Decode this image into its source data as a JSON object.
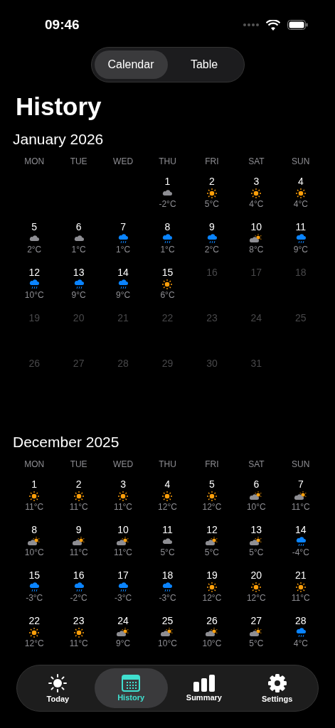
{
  "status_bar": {
    "time": "09:46"
  },
  "segments": [
    {
      "label": "Calendar",
      "selected": true
    },
    {
      "label": "Table",
      "selected": false
    }
  ],
  "title": "History",
  "months": [
    {
      "title": "January 2026",
      "weekdays": [
        "MON",
        "TUE",
        "WED",
        "THU",
        "FRI",
        "SAT",
        "SUN"
      ],
      "days": [
        {
          "kind": "empty"
        },
        {
          "kind": "empty"
        },
        {
          "kind": "empty"
        },
        {
          "kind": "cloud",
          "day": "1",
          "temp": "-2°C"
        },
        {
          "kind": "sun",
          "day": "2",
          "temp": "5°C"
        },
        {
          "kind": "sun",
          "day": "3",
          "temp": "4°C"
        },
        {
          "kind": "sun",
          "day": "4",
          "temp": "4°C"
        },
        {
          "kind": "cloud",
          "day": "5",
          "temp": "2°C"
        },
        {
          "kind": "cloud",
          "day": "6",
          "temp": "1°C"
        },
        {
          "kind": "rain",
          "day": "7",
          "temp": "1°C"
        },
        {
          "kind": "rain",
          "day": "8",
          "temp": "1°C"
        },
        {
          "kind": "rain",
          "day": "9",
          "temp": "2°C"
        },
        {
          "kind": "partly",
          "day": "10",
          "temp": "8°C"
        },
        {
          "kind": "rain",
          "day": "11",
          "temp": "9°C"
        },
        {
          "kind": "rain",
          "day": "12",
          "temp": "10°C"
        },
        {
          "kind": "rain",
          "day": "13",
          "temp": "9°C"
        },
        {
          "kind": "rain",
          "day": "14",
          "temp": "9°C"
        },
        {
          "kind": "sun",
          "day": "15",
          "temp": "6°C"
        },
        {
          "kind": "future",
          "day": "16"
        },
        {
          "kind": "future",
          "day": "17"
        },
        {
          "kind": "future",
          "day": "18"
        },
        {
          "kind": "future",
          "day": "19"
        },
        {
          "kind": "future",
          "day": "20"
        },
        {
          "kind": "future",
          "day": "21"
        },
        {
          "kind": "future",
          "day": "22"
        },
        {
          "kind": "future",
          "day": "23"
        },
        {
          "kind": "future",
          "day": "24"
        },
        {
          "kind": "future",
          "day": "25"
        },
        {
          "kind": "future",
          "day": "26"
        },
        {
          "kind": "future",
          "day": "27"
        },
        {
          "kind": "future",
          "day": "28"
        },
        {
          "kind": "future",
          "day": "29"
        },
        {
          "kind": "future",
          "day": "30"
        },
        {
          "kind": "future",
          "day": "31"
        }
      ]
    },
    {
      "title": "December 2025",
      "weekdays": [
        "MON",
        "TUE",
        "WED",
        "THU",
        "FRI",
        "SAT",
        "SUN"
      ],
      "days": [
        {
          "kind": "sun",
          "day": "1",
          "temp": "11°C"
        },
        {
          "kind": "sun",
          "day": "2",
          "temp": "11°C"
        },
        {
          "kind": "sun",
          "day": "3",
          "temp": "11°C"
        },
        {
          "kind": "sun",
          "day": "4",
          "temp": "12°C"
        },
        {
          "kind": "sun",
          "day": "5",
          "temp": "12°C"
        },
        {
          "kind": "partly",
          "day": "6",
          "temp": "10°C"
        },
        {
          "kind": "partly",
          "day": "7",
          "temp": "11°C"
        },
        {
          "kind": "partly",
          "day": "8",
          "temp": "10°C"
        },
        {
          "kind": "partly",
          "day": "9",
          "temp": "11°C"
        },
        {
          "kind": "partly",
          "day": "10",
          "temp": "11°C"
        },
        {
          "kind": "cloud",
          "day": "11",
          "temp": "5°C"
        },
        {
          "kind": "partly",
          "day": "12",
          "temp": "5°C"
        },
        {
          "kind": "partly",
          "day": "13",
          "temp": "5°C"
        },
        {
          "kind": "rain",
          "day": "14",
          "temp": "-4°C"
        },
        {
          "kind": "rain",
          "day": "15",
          "temp": "-3°C"
        },
        {
          "kind": "rain",
          "day": "16",
          "temp": "-2°C"
        },
        {
          "kind": "rain",
          "day": "17",
          "temp": "-3°C"
        },
        {
          "kind": "rain",
          "day": "18",
          "temp": "-3°C"
        },
        {
          "kind": "sun",
          "day": "19",
          "temp": "12°C"
        },
        {
          "kind": "sun",
          "day": "20",
          "temp": "12°C"
        },
        {
          "kind": "sun",
          "day": "21",
          "temp": "11°C"
        },
        {
          "kind": "sun",
          "day": "22",
          "temp": "12°C"
        },
        {
          "kind": "sun",
          "day": "23",
          "temp": "11°C"
        },
        {
          "kind": "partly",
          "day": "24",
          "temp": "9°C"
        },
        {
          "kind": "partly",
          "day": "25",
          "temp": "10°C"
        },
        {
          "kind": "partly",
          "day": "26",
          "temp": "10°C"
        },
        {
          "kind": "partly",
          "day": "27",
          "temp": "5°C"
        },
        {
          "kind": "rain",
          "day": "28",
          "temp": "4°C"
        }
      ]
    }
  ],
  "tab_bar": [
    {
      "kind": "today",
      "label": "Today",
      "selected": false
    },
    {
      "kind": "history",
      "label": "History",
      "selected": true
    },
    {
      "kind": "summary",
      "label": "Summary",
      "selected": false
    },
    {
      "kind": "settings",
      "label": "Settings",
      "selected": false
    }
  ]
}
